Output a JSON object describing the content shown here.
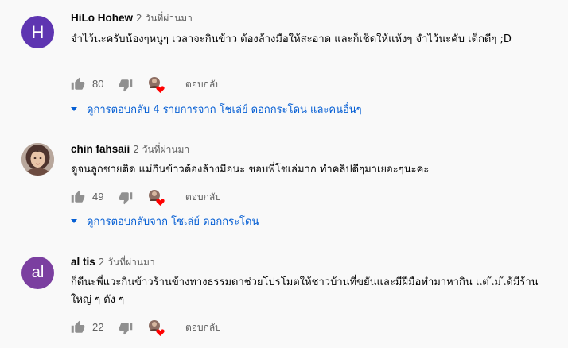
{
  "comments": [
    {
      "author": "HiLo Hohew",
      "time": "2 วันที่ผ่านมา",
      "avatar_letter": "H",
      "avatar_color": "#5e35b1",
      "text": "จำไว้นะครับน้องๆหนูๆ เวลาจะกินข้าว ต้องล้างมือให้สะอาด และก็เช็ดให้แห้งๆ จำไว้นะคับ เด็กดีๆ ;D",
      "likes": "80",
      "reply_label": "ตอบกลับ",
      "view_replies": "ดูการตอบกลับ 4 รายการจาก โชเล่ย์ ดอกกระโดน และคนอื่นๆ"
    },
    {
      "author": "chin fahsaii",
      "time": "2 วันที่ผ่านมา",
      "avatar_type": "photo",
      "text": "ดูจนลูกชายติด แม่กินข้าวต้องล้างมือนะ  ชอบพี่โชเล่มาก ทำคลิปดีๆมาเยอะๆนะคะ",
      "likes": "49",
      "reply_label": "ตอบกลับ",
      "view_replies": "ดูการตอบกลับจาก โชเล่ย์ ดอกกระโดน"
    },
    {
      "author": "al tis",
      "time": "2 วันที่ผ่านมา",
      "avatar_letter": "al",
      "avatar_color": "#7b3fa0",
      "text": "ก็ดีนะพี่แวะกินข้าวร้านข้างทางธรรมดาช่วยโปรโมตให้ชาวบ้านที่ขยันและมีฝีมือทำมาหากิน แต่ไม่ได้มีร้านใหญ่ ๆ ดัง ๆ",
      "likes": "22",
      "reply_label": "ตอบกลับ"
    }
  ],
  "icons": {
    "like": "thumbs-up-icon",
    "dislike": "thumbs-down-icon",
    "creator_heart": "creator-heart-icon",
    "expand": "chevron-down-icon"
  },
  "colors": {
    "link": "#065fd4",
    "heart": "#ff0000",
    "icon": "#909090",
    "secondary_text": "#606060"
  }
}
